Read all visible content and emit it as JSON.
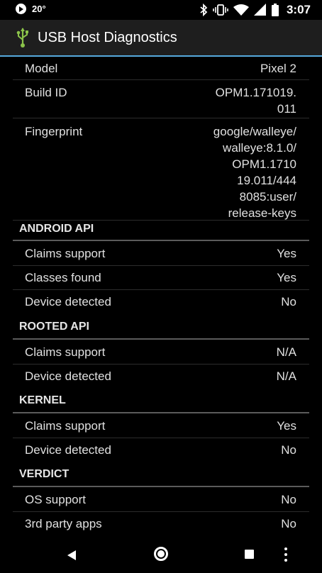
{
  "status_bar": {
    "temperature": "20°",
    "time": "3:07"
  },
  "app_bar": {
    "title": "USB Host Diagnostics"
  },
  "device_info": [
    {
      "label": "Model",
      "value": "Pixel 2"
    },
    {
      "label": "Build ID",
      "value_lines": [
        "OPM1.171019.",
        "011"
      ]
    },
    {
      "label": "Fingerprint",
      "value_lines": [
        "google/walleye/",
        "walleye:8.1.0/",
        "OPM1.1710",
        "19.011/444",
        "8085:user/",
        "release-keys"
      ]
    }
  ],
  "sections": [
    {
      "header": "ANDROID API",
      "rows": [
        {
          "label": "Claims support",
          "value": "Yes"
        },
        {
          "label": "Classes found",
          "value": "Yes"
        },
        {
          "label": "Device detected",
          "value": "No"
        }
      ]
    },
    {
      "header": "ROOTED API",
      "rows": [
        {
          "label": "Claims support",
          "value": "N/A"
        },
        {
          "label": "Device detected",
          "value": "N/A"
        }
      ]
    },
    {
      "header": "KERNEL",
      "rows": [
        {
          "label": "Claims support",
          "value": "Yes"
        },
        {
          "label": "Device detected",
          "value": "No"
        }
      ]
    },
    {
      "header": "VERDICT",
      "rows": [
        {
          "label": "OS support",
          "value": "No"
        },
        {
          "label": "3rd party apps",
          "value": "No"
        }
      ]
    }
  ],
  "colors": {
    "accent_line": "#56a9dd",
    "usb_icon": "#8bc34a",
    "app_bar_bg": "#1e1e1e",
    "background": "#000000"
  },
  "icons": [
    "play-icon",
    "bluetooth-icon",
    "vibrate-icon",
    "wifi-icon",
    "signal-icon",
    "battery-icon",
    "usb-icon",
    "back-icon",
    "home-icon",
    "recents-icon",
    "overflow-menu-icon"
  ]
}
